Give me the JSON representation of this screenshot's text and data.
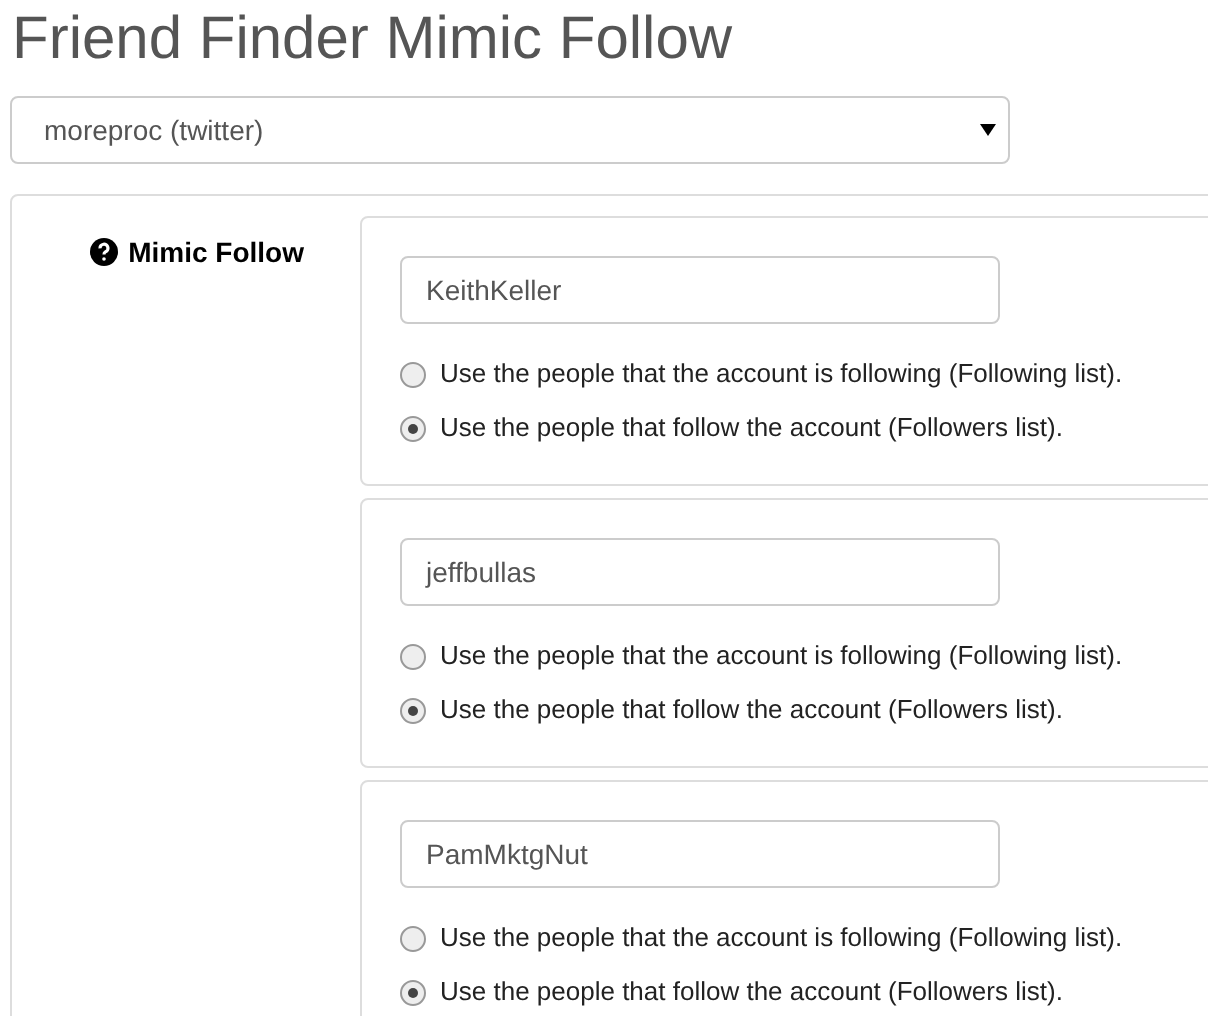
{
  "title": "Friend Finder Mimic Follow",
  "account_select": {
    "value": "moreproc (twitter)"
  },
  "section": {
    "label": "Mimic Follow",
    "entries": [
      {
        "username": "KeithKeller",
        "options": [
          {
            "label": "Use the people that the account is following (Following list).",
            "selected": false
          },
          {
            "label": "Use the people that follow the account (Followers list).",
            "selected": true
          }
        ]
      },
      {
        "username": "jeffbullas",
        "options": [
          {
            "label": "Use the people that the account is following (Following list).",
            "selected": false
          },
          {
            "label": "Use the people that follow the account (Followers list).",
            "selected": true
          }
        ]
      },
      {
        "username": "PamMktgNut",
        "options": [
          {
            "label": "Use the people that the account is following (Following list).",
            "selected": false
          },
          {
            "label": "Use the people that follow the account (Followers list).",
            "selected": true
          }
        ]
      }
    ]
  }
}
